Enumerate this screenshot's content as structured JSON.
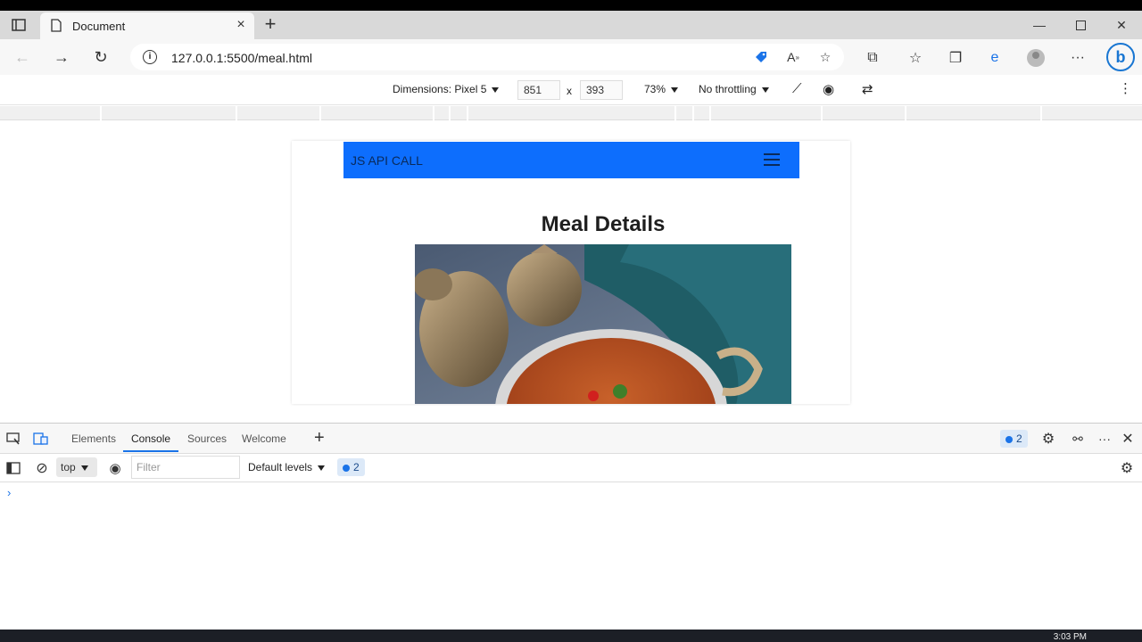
{
  "browser": {
    "tab_title": "Document",
    "url": "127.0.0.1:5500/meal.html"
  },
  "device_toolbar": {
    "dimensions_label": "Dimensions: Pixel 5",
    "width": "851",
    "height": "393",
    "times": "x",
    "zoom": "73%",
    "throttling": "No throttling"
  },
  "page": {
    "brand": "JS API CALL",
    "heading": "Meal Details"
  },
  "devtools": {
    "tabs": [
      "Elements",
      "Console",
      "Sources",
      "Welcome"
    ],
    "active_tab": "Console",
    "issues_count": "2",
    "context": "top",
    "filter_placeholder": "Filter",
    "levels": "Default levels",
    "console_issues": "2",
    "prompt": "›"
  },
  "taskbar": {
    "clock": "3:03 PM"
  },
  "colors": {
    "site_nav": "#0d6efd",
    "devtools_accent": "#1a73e8"
  }
}
